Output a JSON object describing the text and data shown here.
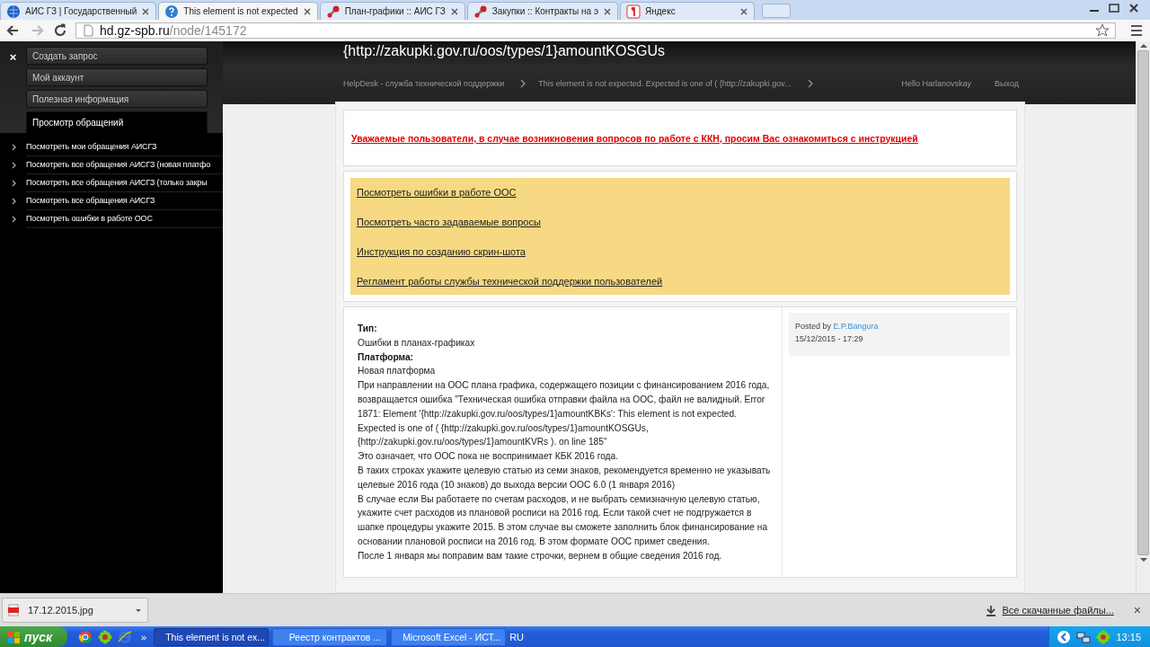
{
  "browser": {
    "tabs": [
      {
        "title": "АИС ГЗ | Государственный",
        "selected": false
      },
      {
        "title": "This element is not expected",
        "selected": true
      },
      {
        "title": "План-графики :: АИС ГЗ",
        "selected": false
      },
      {
        "title": "Закупки :: Контракты на э",
        "selected": false
      },
      {
        "title": "Яндекс",
        "selected": false
      }
    ],
    "address": {
      "host": "hd.gz-spb.ru",
      "path": "/node/145172"
    }
  },
  "sidebar": {
    "close": "×",
    "menu": [
      {
        "label": "Создать запрос",
        "selected": false
      },
      {
        "label": "Мой аккаунт",
        "selected": false
      },
      {
        "label": "Полезная информация",
        "selected": false
      },
      {
        "label": "Просмотр обращений",
        "selected": true
      }
    ],
    "links": [
      "Посмотреть мои обращения АИСГЗ",
      "Посмотреть все обращения АИСГЗ (новая платфо",
      "Посмотреть все обращения АИСГЗ (только закры",
      "Посмотреть все обращения АИСГЗ",
      "Посмотреть ошибки в работе ООС"
    ]
  },
  "header": {
    "title": "{http://zakupki.gov.ru/oos/types/1}amountKOSGUs",
    "breadcrumbs": [
      "HelpDesk - служба технической поддержки",
      "This element is not expected. Expected is one of ( {http://zakupki.gov..."
    ],
    "user": "Hello Harlanovskay",
    "logout": "Выход"
  },
  "notice": "Уважаемые пользователи, в случае возникновения вопросов по работе с ККН, просим Вас ознакомиться с инструкцией",
  "quick_links": [
    "Посмотреть ошибки в работе ООС",
    "Посмотреть часто задаваемые вопросы",
    "Инструкция по созданию скрин-шота",
    "Регламент работы службы технической поддержки пользователей"
  ],
  "post": {
    "body": [
      {
        "kind": "label",
        "text": "Тип:"
      },
      {
        "kind": "text",
        "text": "Ошибки в планах-графиках"
      },
      {
        "kind": "label",
        "text": "Платформа:"
      },
      {
        "kind": "text",
        "text": "Новая платформа"
      },
      {
        "kind": "text",
        "text": "При направлении на ООС плана графика, содержащего позиции с финансированием 2016 года, возвращается ошибка \"Техническая ошибка отправки файла на ООС, файл не валидный. Error 1871: Element '{http://zakupki.gov.ru/oos/types/1}amountKBKs': This element is not expected. Expected is one of ( {http://zakupki.gov.ru/oos/types/1}amountKOSGUs, {http://zakupki.gov.ru/oos/types/1}amountKVRs ). on line 185\""
      },
      {
        "kind": "text",
        "text": "Это означает, что ООС пока не воспринимает КБК 2016 года."
      },
      {
        "kind": "text",
        "text": "В таких строках укажите целевую статью из семи знаков, рекомендуется временно не указывать целевые 2016 года (10 знаков) до выхода версии ООС 6.0 (1 января 2016)"
      },
      {
        "kind": "text",
        "text": "В случае если Вы работаете по счетам расходов, и не выбрать семизначную целевую статью, укажите счет расходов из плановой росписи на 2016 год. Если такой счет не подгружается в шапке процедуры укажите 2015. В этом случае вы сможете заполнить блок финансирование на основании плановой росписи на 2016 год. В этом формате ООС примет сведения."
      },
      {
        "kind": "text",
        "text": "После 1 января мы поправим вам такие строчки, вернем в общие сведения 2016 год."
      }
    ],
    "meta": {
      "posted_by": "Posted by",
      "author": "E.P.Bangura",
      "date": "15/12/2015 - 17:29"
    }
  },
  "downloads": {
    "file": "17.12.2015.jpg",
    "all": "Все скачанные файлы...",
    "close": "×"
  },
  "taskbar": {
    "start": "пуск",
    "more": "»",
    "tasks": [
      {
        "title": "This element is not ex...",
        "selected": true
      },
      {
        "title": "Реестр контрактов ...",
        "selected": false
      },
      {
        "title": "Microsoft Excel - ИСТ...",
        "selected": false
      }
    ],
    "language": "RU",
    "clock": "13:15"
  }
}
